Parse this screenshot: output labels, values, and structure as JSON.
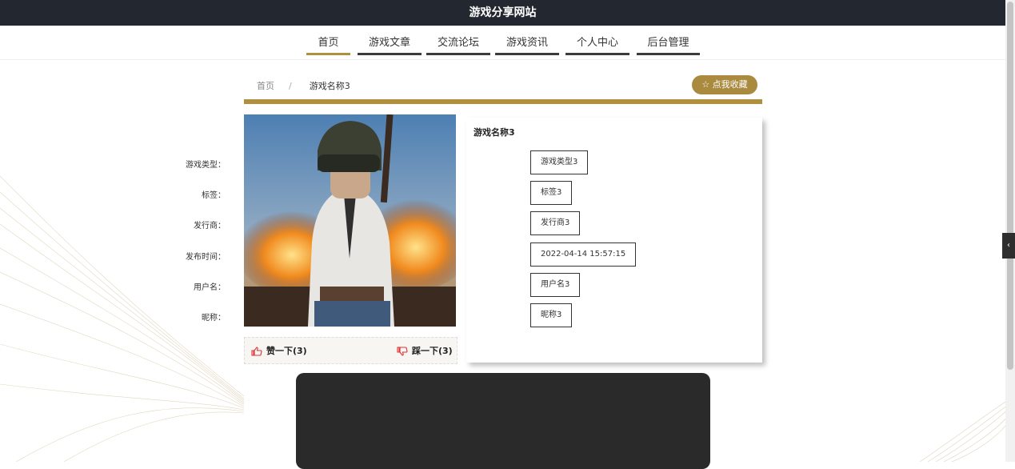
{
  "header": {
    "title": "游戏分享网站"
  },
  "nav": {
    "items": [
      "首页",
      "游戏文章",
      "交流论坛",
      "游戏资讯",
      "个人中心",
      "后台管理"
    ],
    "active_index": 0
  },
  "breadcrumb": {
    "home": "首页",
    "separator": "/",
    "current": "游戏名称3"
  },
  "favorite_button": {
    "label": "☆ 点我收藏"
  },
  "game": {
    "name": "游戏名称3",
    "fields": [
      {
        "label": "游戏类型：",
        "value": "游戏类型3"
      },
      {
        "label": "标签：",
        "value": "标签3"
      },
      {
        "label": "发行商：",
        "value": "发行商3"
      },
      {
        "label": "发布时间：",
        "value": "2022-04-14 15:57:15"
      },
      {
        "label": "用户名：",
        "value": "用户名3"
      },
      {
        "label": "昵称：",
        "value": "昵称3"
      }
    ]
  },
  "votes": {
    "like_label": "赞一下(3)",
    "dislike_label": "踩一下(3)"
  },
  "colors": {
    "accent": "#b0903e",
    "dark": "#23272f"
  },
  "side_tab": {
    "icon": "‹"
  }
}
